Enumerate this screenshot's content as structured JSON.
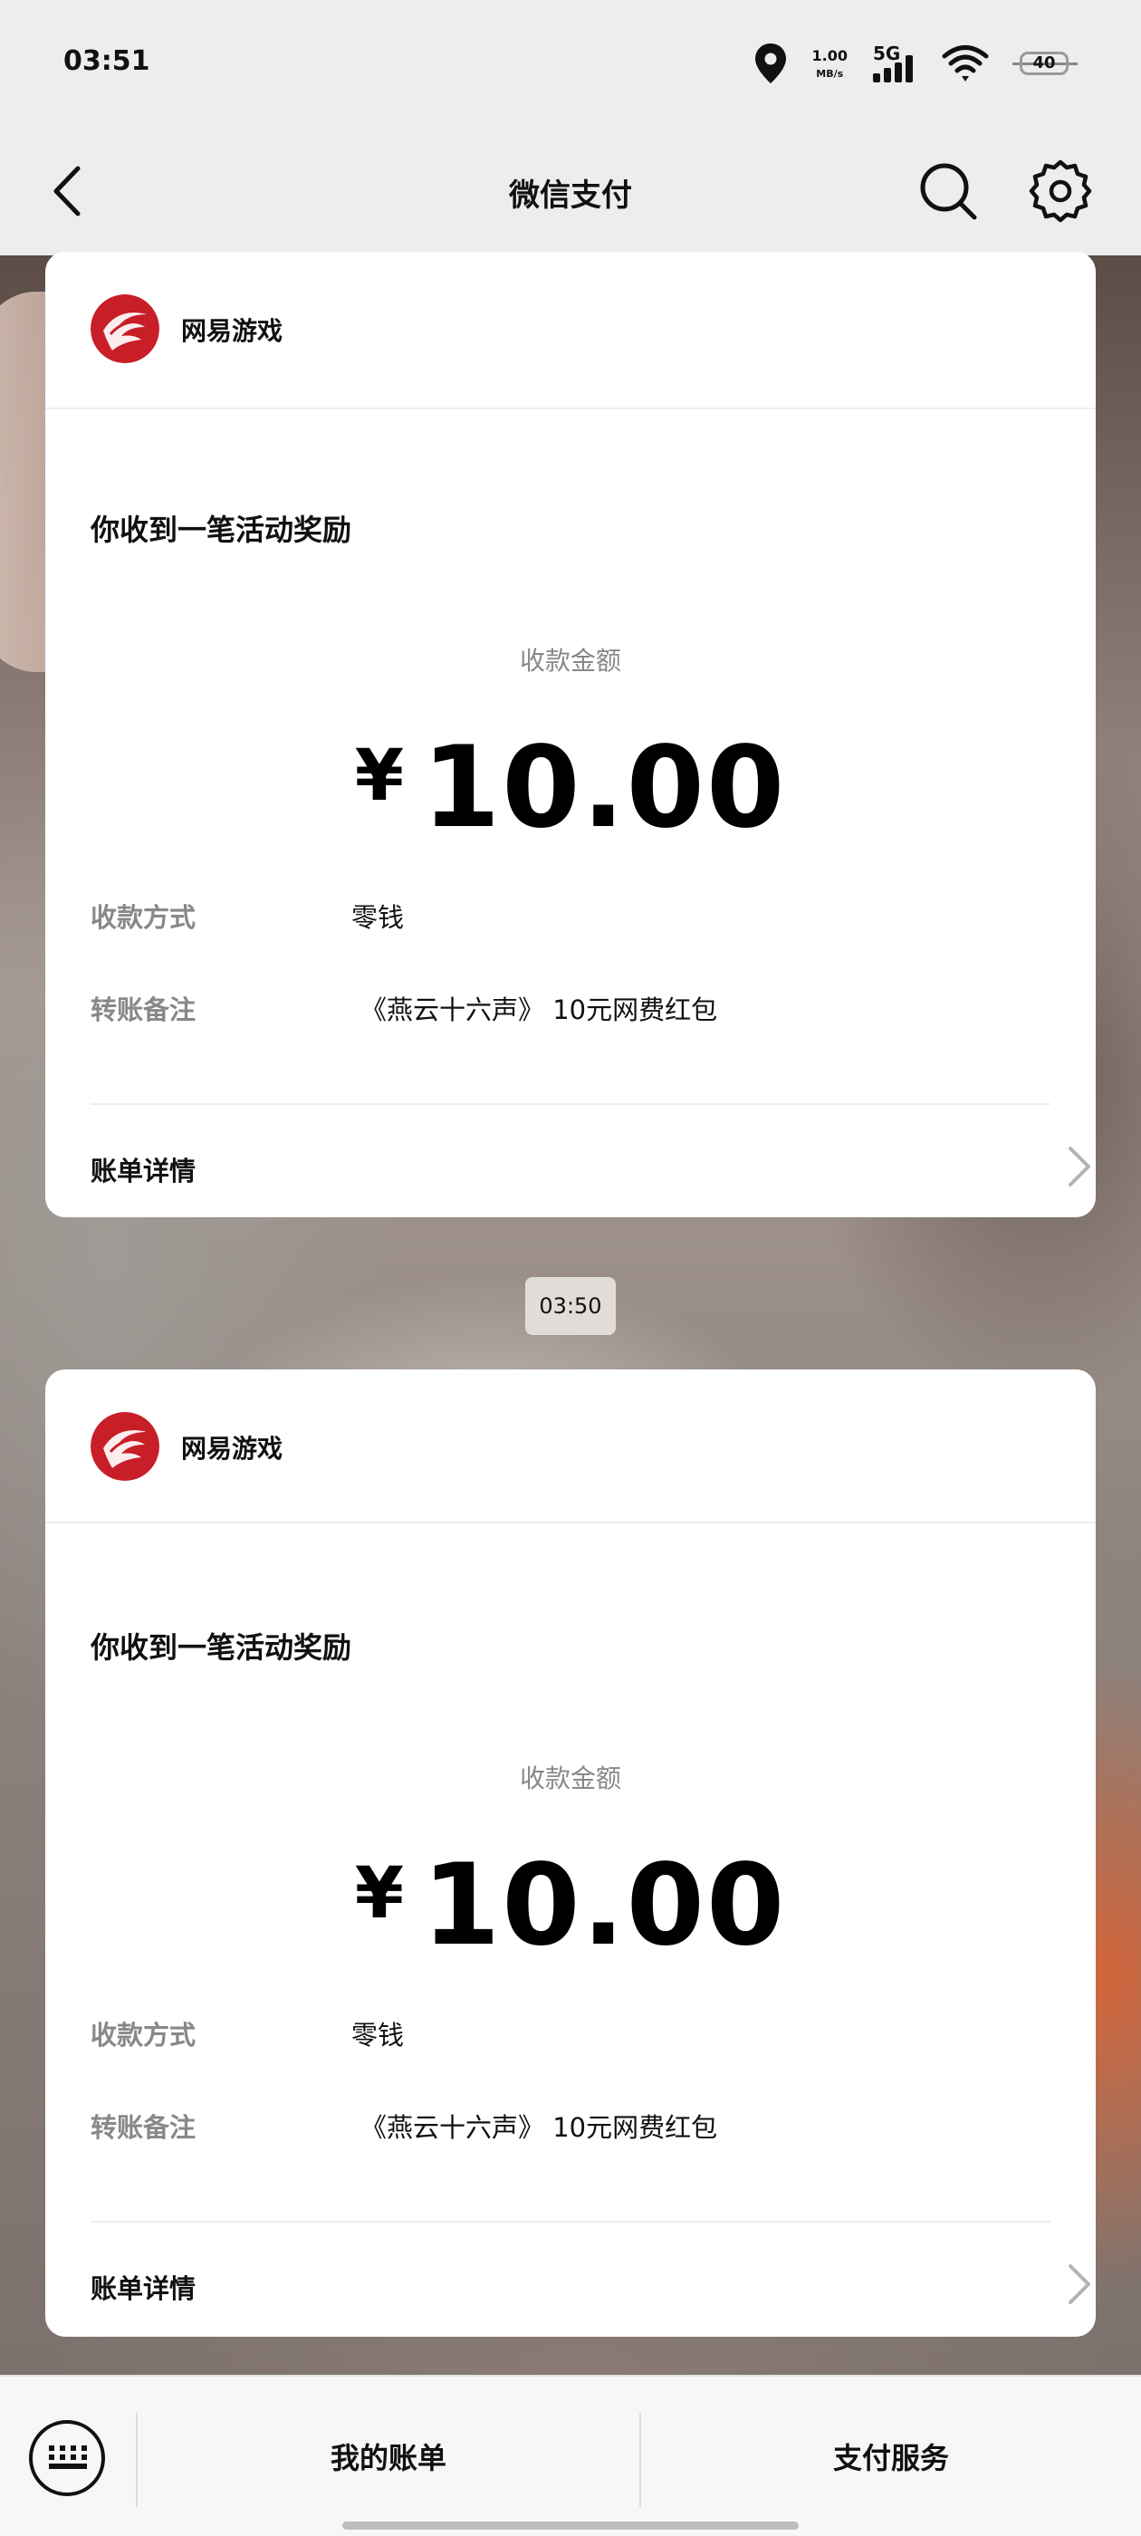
{
  "status_bar": {
    "time": "03:51",
    "net_speed_value": "1.00",
    "net_speed_unit": "MB/s",
    "network_type": "5G",
    "battery": "40"
  },
  "nav": {
    "title": "微信支付"
  },
  "cards": [
    {
      "merchant": "网易游戏",
      "title": "你收到一笔活动奖励",
      "amount_label": "收款金额",
      "currency": "¥",
      "amount": "10.00",
      "method_label": "收款方式",
      "method_value": "零钱",
      "remark_label": "转账备注",
      "remark_value": "《燕云十六声》 10元网费红包",
      "details_label": "账单详情"
    },
    {
      "merchant": "网易游戏",
      "title": "你收到一笔活动奖励",
      "amount_label": "收款金额",
      "currency": "¥",
      "amount": "10.00",
      "method_label": "收款方式",
      "method_value": "零钱",
      "remark_label": "转账备注",
      "remark_value": "《燕云十六声》 10元网费红包",
      "details_label": "账单详情"
    }
  ],
  "chat": {
    "timestamp": "03:50"
  },
  "bottom_menu": {
    "items": [
      "我的账单",
      "支付服务"
    ]
  }
}
